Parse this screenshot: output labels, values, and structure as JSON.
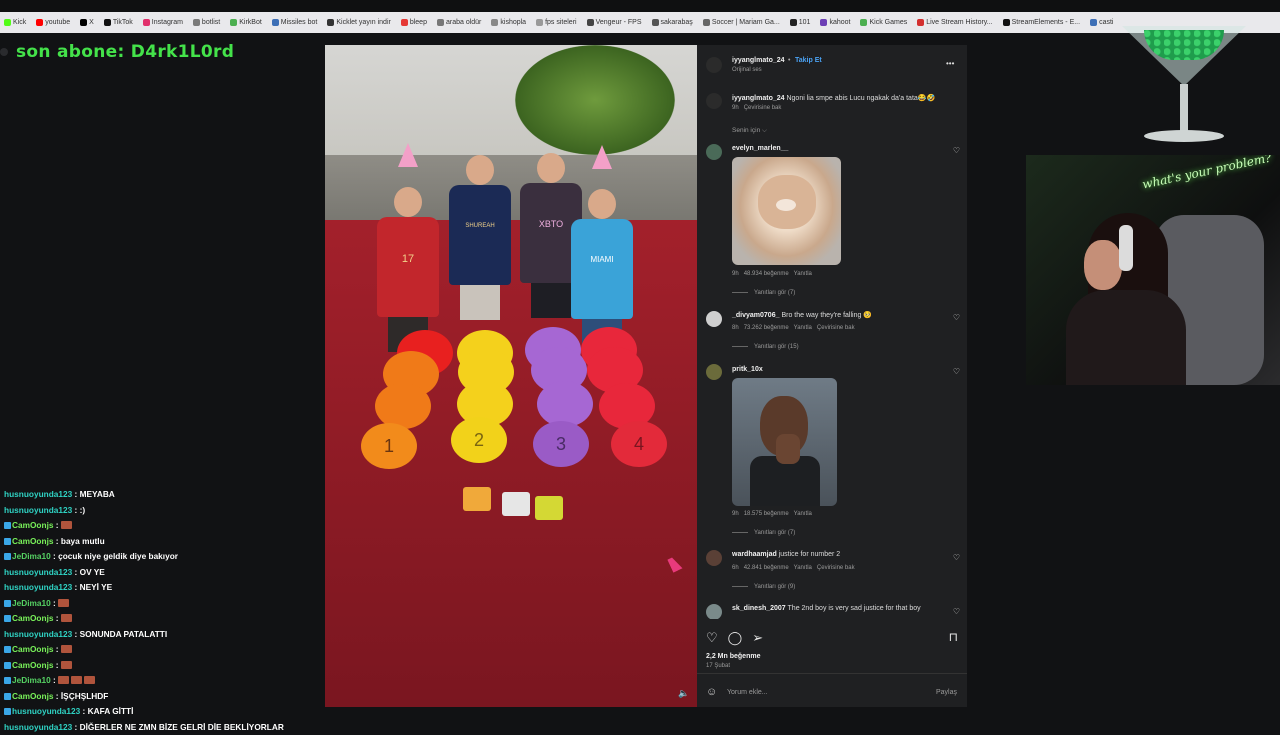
{
  "bookmarks": [
    "Kick",
    "youtube",
    "X",
    "TikTok",
    "Instagram",
    "botlist",
    "KirkBot",
    "Missiles bot",
    "Kicklet yayın indir",
    "bleep",
    "araba oldür",
    "kishopla",
    "fps siteleri",
    "Vengeur - FPS",
    "sakarabaş",
    "Soccer | Mariam Ga...",
    "101",
    "kahoot",
    "Kick Games",
    "Live Stream History...",
    "StreamElements - E...",
    "casti"
  ],
  "overlay": {
    "last_sub": "son abone: D4rk1L0rd"
  },
  "post": {
    "author": "iyyanglmato_24",
    "follow_label": "Takip Et",
    "audio": "Orijinal ses",
    "menu": "•••",
    "caption_user": "iyyanglmato_24",
    "caption_text": "Ngoni lia smpe abis Lucu ngakak da'a tata😂🤣",
    "caption_time": "9h",
    "caption_translate": "Çevirisine bak",
    "filter": "Senin için",
    "likes": "2,2 Mn beğenme",
    "date": "17 Şubat",
    "comment_placeholder": "Yorum ekle...",
    "share": "Paylaş"
  },
  "comments": [
    {
      "user": "evelyn_marlen__",
      "text": "",
      "time": "9h",
      "likes": "48.934 beğenme",
      "reply": "Yanıtla",
      "translate": "",
      "replies": "Yanıtları gör (7)"
    },
    {
      "user": "_divyam0706_",
      "text": "Bro the way they're falling 🥺",
      "time": "8h",
      "likes": "73.262 beğenme",
      "reply": "Yanıtla",
      "translate": "Çevirisine bak",
      "replies": "Yanıtları gör (15)"
    },
    {
      "user": "pritk_10x",
      "text": "",
      "time": "9h",
      "likes": "18.575 beğenme",
      "reply": "Yanıtla",
      "translate": "",
      "replies": "Yanıtları gör (7)"
    },
    {
      "user": "wardhaamjad",
      "text": "justice for number 2",
      "time": "6h",
      "likes": "42.841 beğenme",
      "reply": "Yanıtla",
      "translate": "Çevirisine bak",
      "replies": "Yanıtları gör (9)"
    },
    {
      "user": "sk_dinesh_2007",
      "text": "The 2nd boy is very sad justice for that boy",
      "time": "",
      "likes": "",
      "reply": "",
      "translate": "",
      "replies": ""
    }
  ],
  "chat": [
    {
      "user": "husnuoyunda123",
      "sep": " : ",
      "text": "MEYABA",
      "badge": false,
      "emotes": 0,
      "color": "u1"
    },
    {
      "user": "husnuoyunda123",
      "sep": " : ",
      "text": ":)",
      "badge": false,
      "emotes": 0,
      "color": "u1"
    },
    {
      "user": "CamOonjs",
      "sep": " : ",
      "text": "",
      "badge": true,
      "emotes": 1,
      "color": "u2"
    },
    {
      "user": "CamOonjs",
      "sep": " : ",
      "text": "baya mutlu",
      "badge": true,
      "emotes": 0,
      "color": "u2"
    },
    {
      "user": "JeDima10",
      "sep": " : ",
      "text": "çocuk niye geldik diye bakıyor",
      "badge": true,
      "emotes": 0,
      "color": "u3"
    },
    {
      "user": "husnuoyunda123",
      "sep": " : ",
      "text": "OV YE",
      "badge": false,
      "emotes": 0,
      "color": "u1"
    },
    {
      "user": "husnuoyunda123",
      "sep": " : ",
      "text": "NEYİ YE",
      "badge": false,
      "emotes": 0,
      "color": "u1"
    },
    {
      "user": "JeDima10",
      "sep": " : ",
      "text": "",
      "badge": true,
      "emotes": 1,
      "color": "u3"
    },
    {
      "user": "CamOonjs",
      "sep": " : ",
      "text": "",
      "badge": true,
      "emotes": 1,
      "color": "u2"
    },
    {
      "user": "husnuoyunda123",
      "sep": " : ",
      "text": "SONUNDA PATALATTI",
      "badge": false,
      "emotes": 0,
      "color": "u1"
    },
    {
      "user": "CamOonjs",
      "sep": " : ",
      "text": "",
      "badge": true,
      "emotes": 1,
      "color": "u2"
    },
    {
      "user": "CamOonjs",
      "sep": " : ",
      "text": "",
      "badge": true,
      "emotes": 1,
      "color": "u2"
    },
    {
      "user": "JeDima10",
      "sep": " : ",
      "text": "",
      "badge": true,
      "emotes": 3,
      "color": "u3"
    },
    {
      "user": "CamOonjs",
      "sep": " : ",
      "text": "İŞÇHŞLHDF",
      "badge": true,
      "emotes": 0,
      "color": "u2"
    },
    {
      "user": "husnuoyunda123",
      "sep": " : ",
      "text": "KAFA GİTTİ",
      "badge": true,
      "emotes": 0,
      "color": "u1"
    },
    {
      "user": "husnuoyunda123",
      "sep": " : ",
      "text": "DİĞERLER NE ZMN BİZE GELRİ DİE BEKLİYORLAR",
      "badge": false,
      "emotes": 0,
      "color": "u1"
    }
  ],
  "webcam": {
    "neon_text": "what's your problem?"
  },
  "video": {
    "balloon_numbers": [
      "1",
      "2",
      "3",
      "4"
    ],
    "shirt_texts": [
      "17",
      "SHUREAH",
      "XBTO",
      "MIAMI"
    ]
  },
  "colors": {
    "accent_green": "#44e24a",
    "follow_blue": "#4aa1f2",
    "panel_bg": "#1f2022",
    "carpet": "#8a1a24"
  }
}
